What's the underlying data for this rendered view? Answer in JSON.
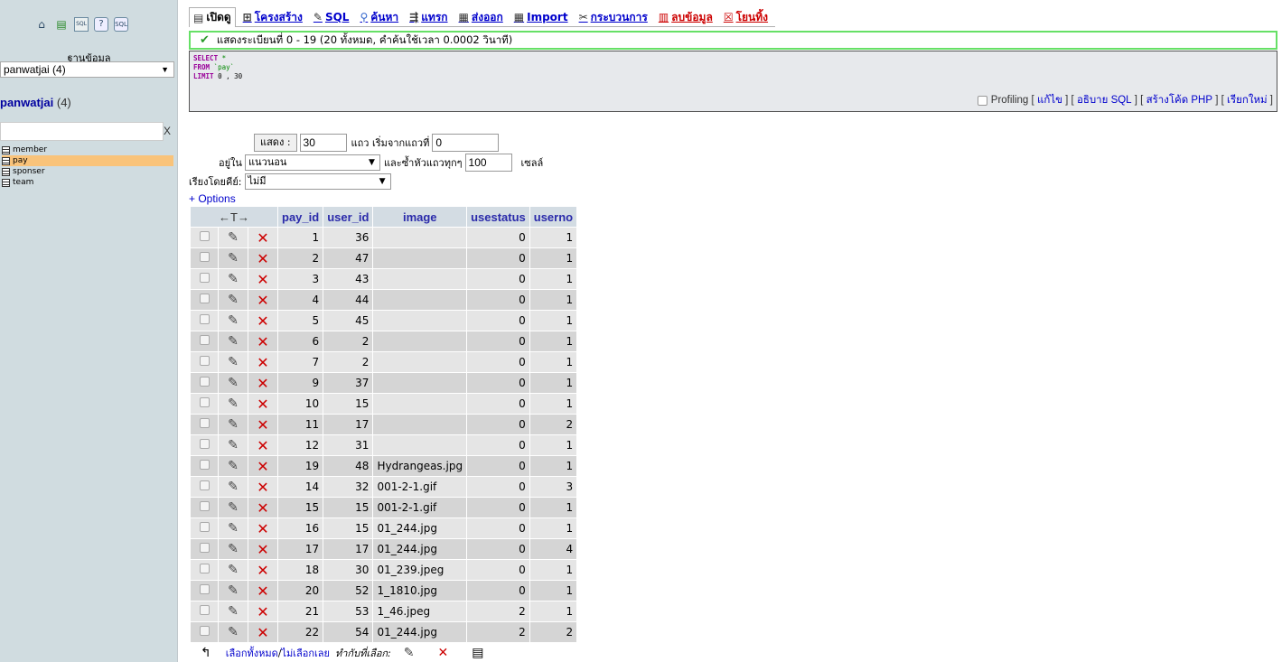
{
  "sidebar": {
    "db_label": "ฐานข้อมูล",
    "db_selected": "panwatjai (4)",
    "db_name": "panwatjai",
    "db_count": "(4)",
    "filter_clear": "X",
    "tables": [
      "member",
      "pay",
      "sponser",
      "team"
    ],
    "active_table": "pay",
    "nav_icons": [
      "home-icon",
      "table-icon",
      "sql-icon",
      "help-icon",
      "docs-icon"
    ]
  },
  "tabs": [
    {
      "label": "เปิดดู",
      "icon": "browse-icon"
    },
    {
      "label": "โครงสร้าง",
      "icon": "structure-icon"
    },
    {
      "label": "SQL",
      "icon": "sql-icon"
    },
    {
      "label": "ค้นหา",
      "icon": "search-icon"
    },
    {
      "label": "แทรก",
      "icon": "insert-icon"
    },
    {
      "label": "ส่งออก",
      "icon": "export-icon"
    },
    {
      "label": "Import",
      "icon": "import-icon"
    },
    {
      "label": "กระบวนการ",
      "icon": "operations-icon"
    },
    {
      "label": "ลบข้อมูล",
      "icon": "empty-icon"
    },
    {
      "label": "โยนทิ้ง",
      "icon": "drop-icon"
    }
  ],
  "success_message": "แสดงระเบียนที่ 0 - 19 (20 ทั้งหมด, คำค้นใช้เวลา 0.0002 วินาที)",
  "sql": {
    "select": "SELECT",
    "star": " *",
    "from": "FROM",
    "table": " `pay`",
    "limit": "LIMIT",
    "limit_val": " 0 , 30"
  },
  "profiling": {
    "label": "Profiling",
    "links": [
      "แก้ไข",
      "อธิบาย SQL",
      "สร้างโค้ด PHP",
      "เรียกใหม่"
    ]
  },
  "nav": {
    "show_button": "แสดง :",
    "rows_value": "30",
    "rows_label": "แถว เริ่มจากแถวที่",
    "start_value": "0",
    "mode_prefix": "อยู่ใน",
    "mode_value": "แนวนอน",
    "repeat_label": "และซ้ำหัวแถวทุกๆ",
    "repeat_value": "100",
    "cells_label": "เซลล์",
    "sort_label": "เรียงโดยคีย์:",
    "sort_value": "ไม่มี",
    "options_link": "+ Options"
  },
  "table": {
    "nav_header": "←T→",
    "columns": [
      "pay_id",
      "user_id",
      "image",
      "usestatus",
      "userno"
    ],
    "rows": [
      [
        "1",
        "36",
        "",
        "0",
        "1"
      ],
      [
        "2",
        "47",
        "",
        "0",
        "1"
      ],
      [
        "3",
        "43",
        "",
        "0",
        "1"
      ],
      [
        "4",
        "44",
        "",
        "0",
        "1"
      ],
      [
        "5",
        "45",
        "",
        "0",
        "1"
      ],
      [
        "6",
        "2",
        "",
        "0",
        "1"
      ],
      [
        "7",
        "2",
        "",
        "0",
        "1"
      ],
      [
        "9",
        "37",
        "",
        "0",
        "1"
      ],
      [
        "10",
        "15",
        "",
        "0",
        "1"
      ],
      [
        "11",
        "17",
        "",
        "0",
        "2"
      ],
      [
        "12",
        "31",
        "",
        "0",
        "1"
      ],
      [
        "19",
        "48",
        "Hydrangeas.jpg",
        "0",
        "1"
      ],
      [
        "14",
        "32",
        "001-2-1.gif",
        "0",
        "3"
      ],
      [
        "15",
        "15",
        "001-2-1.gif",
        "0",
        "1"
      ],
      [
        "16",
        "15",
        "01_244.jpg",
        "0",
        "1"
      ],
      [
        "17",
        "17",
        "01_244.jpg",
        "0",
        "4"
      ],
      [
        "18",
        "30",
        "01_239.jpeg",
        "0",
        "1"
      ],
      [
        "20",
        "52",
        "1_1810.jpg",
        "0",
        "1"
      ],
      [
        "21",
        "53",
        "1_46.jpeg",
        "2",
        "1"
      ],
      [
        "22",
        "54",
        "01_244.jpg",
        "2",
        "2"
      ]
    ]
  },
  "footer": {
    "select_all": "เลือกทั้งหมด",
    "separator": " / ",
    "deselect_all": "ไม่เลือกเลย",
    "with_selected": "ทำกับที่เลือก:"
  }
}
